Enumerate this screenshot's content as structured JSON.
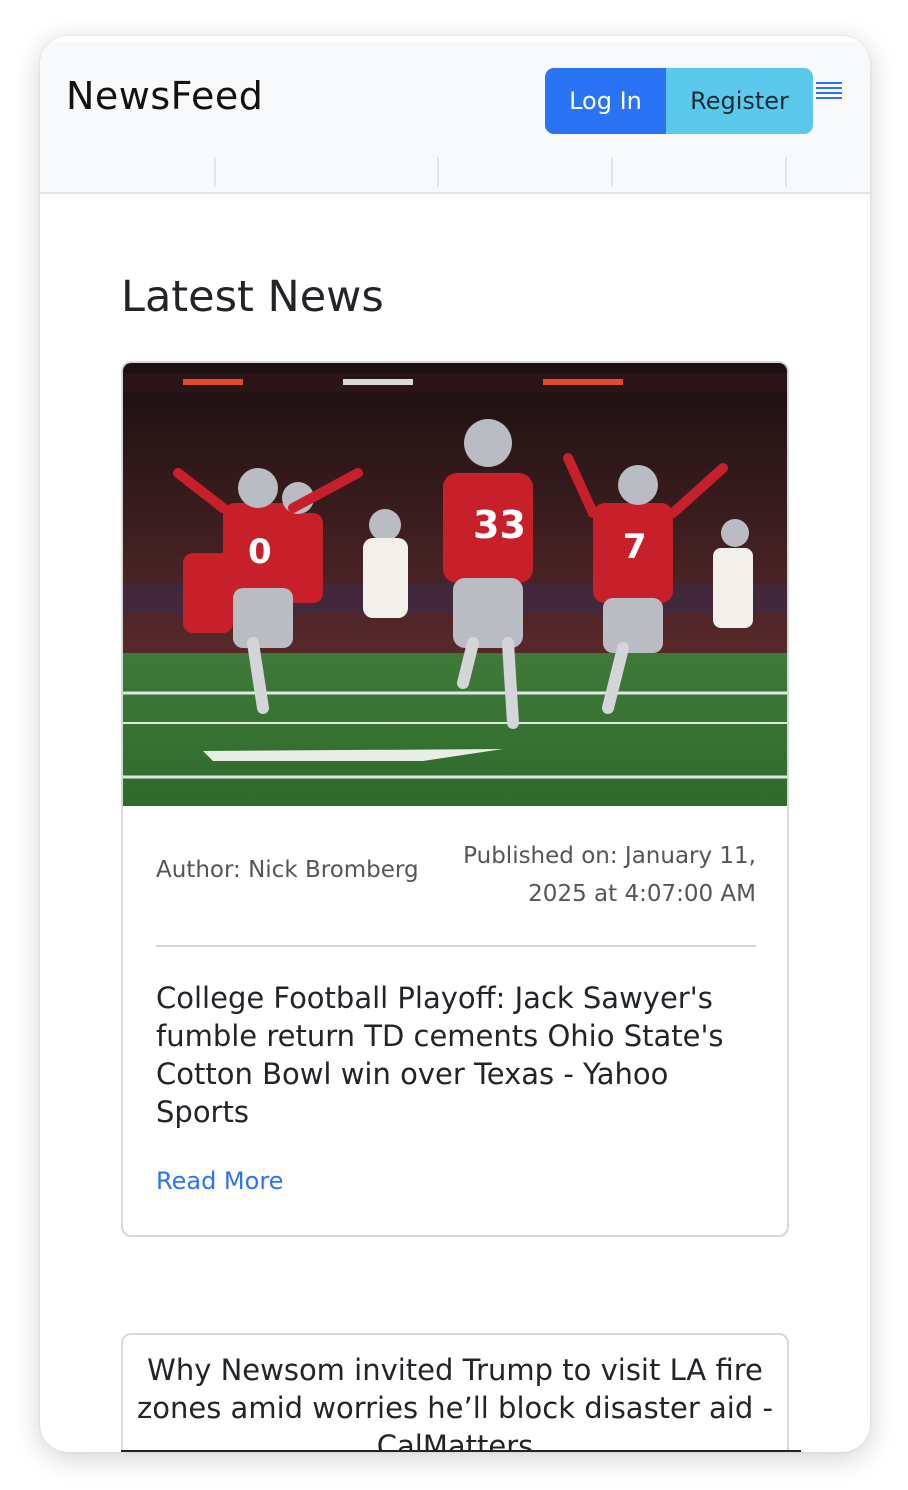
{
  "app": {
    "brand": "NewsFeed"
  },
  "nav": {
    "login_label": "Log In",
    "register_label": "Register",
    "menu_icon": "hamburger-menu-icon"
  },
  "colors": {
    "primary": "#2b73f5",
    "info": "#5bc9eb",
    "muted_text": "#555555"
  },
  "main": {
    "heading": "Latest News",
    "articles": [
      {
        "image": "football-celebration-photo",
        "author": "Author: Nick Bromberg",
        "published": "Published on: January 11, 2025 at 4:07:00 AM",
        "title": "College Football Playoff: Jack Sawyer's fumble return TD cements Ohio State's Cotton Bowl win over Texas - Yahoo Sports",
        "read_more": "Read More"
      },
      {
        "title": "Why Newsom invited Trump to visit LA fire zones amid worries he’ll block disaster aid - CalMatters"
      }
    ]
  }
}
